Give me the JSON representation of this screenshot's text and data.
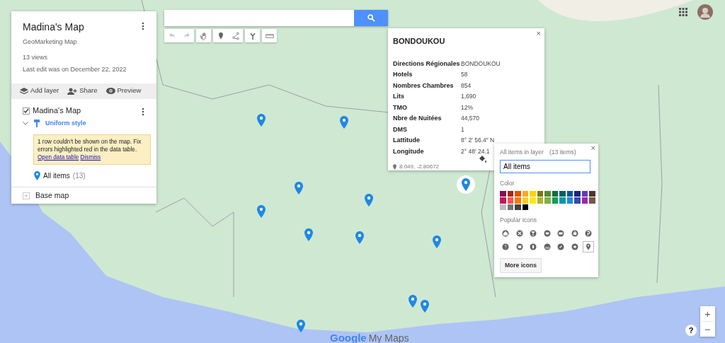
{
  "panel": {
    "title": "Madina's Map",
    "subtitle": "GeoMarketing Map",
    "views": "13 views",
    "last_edit": "Last edit was on December 22, 2022",
    "actions": [
      {
        "kind": "layers",
        "label": "Add layer"
      },
      {
        "kind": "share",
        "label": "Share"
      },
      {
        "kind": "preview",
        "label": "Preview"
      }
    ],
    "layer": {
      "name": "Madina's Map",
      "checked": true,
      "expanded": true,
      "style": "Uniform style",
      "warning": "1 row couldn't be shown on the map. Fix errors highlighted red in the data table.",
      "warning_links": [
        "Open data table",
        "Dismiss"
      ],
      "items_label": "All items",
      "items_count": "(13)"
    },
    "base_map": "Base map"
  },
  "toolbar": [
    {
      "kind": "undo",
      "disabled": true
    },
    {
      "kind": "redo",
      "disabled": true
    },
    {
      "kind": "hand",
      "disabled": false
    },
    {
      "kind": "marker",
      "disabled": false
    },
    {
      "kind": "line",
      "disabled": false
    },
    {
      "kind": "route",
      "disabled": false
    },
    {
      "kind": "ruler",
      "disabled": false
    }
  ],
  "markers": [
    {
      "selected": false
    },
    {
      "selected": false
    },
    {
      "selected": false
    },
    {
      "selected": false
    },
    {
      "selected": false
    },
    {
      "selected": false
    },
    {
      "selected": false
    },
    {
      "selected": false
    },
    {
      "selected": true
    },
    {
      "selected": false
    },
    {
      "selected": false
    },
    {
      "selected": false
    }
  ],
  "info": {
    "title": "BONDOUKOU",
    "close": "×",
    "rows": [
      {
        "label": "Directions Régionales",
        "value": "BONDOUKOU"
      },
      {
        "label": "Hotels",
        "value": "58"
      },
      {
        "label": "Nombres Chambres",
        "value": "854"
      },
      {
        "label": "Lits",
        "value": "1,690"
      },
      {
        "label": "TMO",
        "value": "12%"
      },
      {
        "label": "Nbre de Nuitées",
        "value": "44,570"
      },
      {
        "label": "DMS",
        "value": "1"
      },
      {
        "label": "Lattitude",
        "value": "8° 2′ 56.4″ N"
      },
      {
        "label": "Longitude",
        "value": "2° 48′ 24.1"
      }
    ],
    "coords": "8.049, -2.80672"
  },
  "style_popup": {
    "close": "×",
    "heading": "All items in layer",
    "count": "(13 items)",
    "name_value": "All items",
    "color_label": "Color",
    "colors": [
      {
        "color": "#880e4f"
      },
      {
        "color": "#a52714"
      },
      {
        "color": "#e65100"
      },
      {
        "color": "#f9a825"
      },
      {
        "color": "#ffd600"
      },
      {
        "color": "#817717"
      },
      {
        "color": "#558b2f"
      },
      {
        "color": "#097138"
      },
      {
        "color": "#006064"
      },
      {
        "color": "#01579b"
      },
      {
        "color": "#1a237e"
      },
      {
        "color": "#673ab7"
      },
      {
        "color": "#4e342e"
      },
      {
        "color": "#c2185b"
      },
      {
        "color": "#ff5252"
      },
      {
        "color": "#f57c00"
      },
      {
        "color": "#ffca28"
      },
      {
        "color": "#ffea00"
      },
      {
        "color": "#afb42b"
      },
      {
        "color": "#7cb342"
      },
      {
        "color": "#0f9d58"
      },
      {
        "color": "#0097a7"
      },
      {
        "color": "#1e88e5"
      },
      {
        "color": "#3949ab"
      },
      {
        "color": "#9c27b0"
      },
      {
        "color": "#795548"
      },
      {
        "color": "#bdbdbd"
      },
      {
        "color": "#757575"
      },
      {
        "color": "#424242"
      },
      {
        "color": "#000000"
      }
    ],
    "icons_label": "Popular Icons",
    "icons": [
      {
        "selected": false
      },
      {
        "selected": false
      },
      {
        "selected": false
      },
      {
        "selected": false
      },
      {
        "selected": false
      },
      {
        "selected": false
      },
      {
        "selected": false
      },
      {
        "selected": false
      },
      {
        "selected": false
      },
      {
        "selected": false
      },
      {
        "selected": false
      },
      {
        "selected": false
      },
      {
        "selected": false
      },
      {
        "selected": true
      }
    ],
    "more_button": "More icons"
  },
  "zoom": {
    "in": "+",
    "out": "−"
  },
  "help": "?",
  "brand": {
    "logo": "Google",
    "product": "My Maps"
  }
}
